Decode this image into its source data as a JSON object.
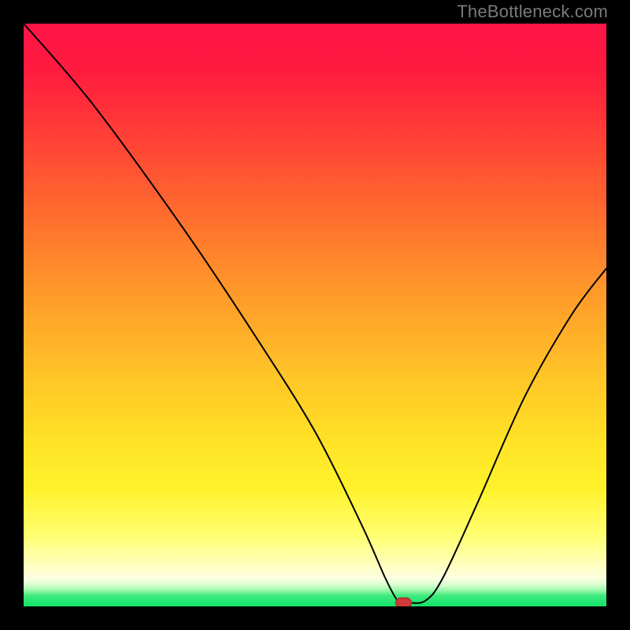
{
  "watermark": "TheBottleneck.com",
  "chart_data": {
    "type": "line",
    "title": "",
    "xlabel": "",
    "ylabel": "",
    "xlim": [
      0,
      100
    ],
    "ylim": [
      0,
      100
    ],
    "grid": false,
    "legend": false,
    "series": [
      {
        "name": "bottleneck-curve",
        "x": [
          0,
          12,
          28,
          40,
          50,
          58,
          62,
          64,
          65,
          66,
          69,
          72,
          78,
          86,
          94,
          100
        ],
        "values": [
          100,
          86,
          64,
          46,
          30,
          14,
          5,
          1.2,
          0.6,
          0.6,
          1.0,
          5,
          18,
          36,
          50,
          58
        ]
      }
    ],
    "marker": {
      "name": "optimal-point",
      "x": 65.2,
      "y": 0.6,
      "color": "#cf3b3b"
    },
    "background_gradient": {
      "direction": "vertical",
      "stops": [
        {
          "pos": 0.0,
          "color": "#ff1447"
        },
        {
          "pos": 0.5,
          "color": "#ff9a29"
        },
        {
          "pos": 0.8,
          "color": "#fff22c"
        },
        {
          "pos": 0.95,
          "color": "#fbffe0"
        },
        {
          "pos": 1.0,
          "color": "#10e46a"
        }
      ]
    }
  }
}
